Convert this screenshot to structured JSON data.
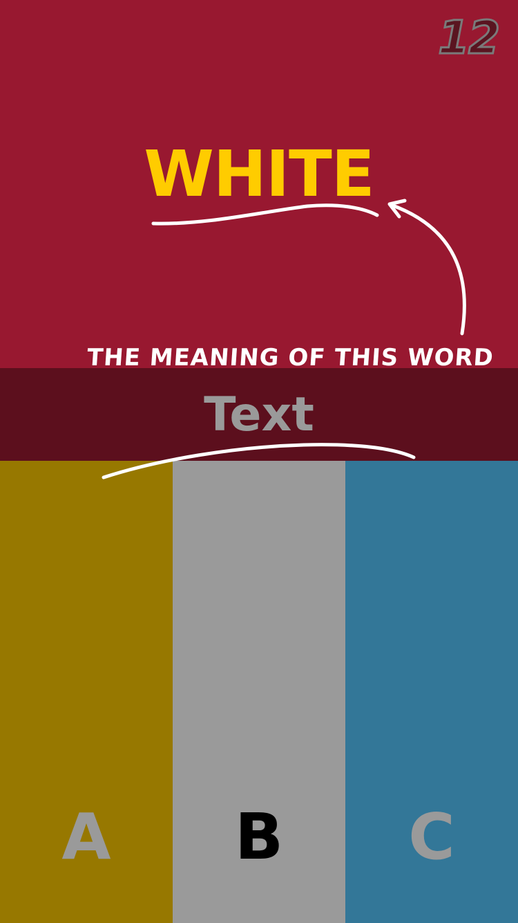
{
  "score": "12",
  "word": {
    "text": "WHITE",
    "color": "#ffcc00"
  },
  "hint": {
    "text": "THE MEANING OF THIS WORD"
  },
  "text_label": {
    "text": "Text",
    "color": "#9a9a9a"
  },
  "colors": {
    "background": "#981830",
    "band": "#5c0f1d"
  },
  "options": [
    {
      "letter": "A",
      "fill": "#977800",
      "letter_color": "#9a9a9a"
    },
    {
      "letter": "B",
      "fill": "#9a9a9a",
      "letter_color": "#000000"
    },
    {
      "letter": "C",
      "fill": "#337798",
      "letter_color": "#9a9a9a"
    }
  ]
}
